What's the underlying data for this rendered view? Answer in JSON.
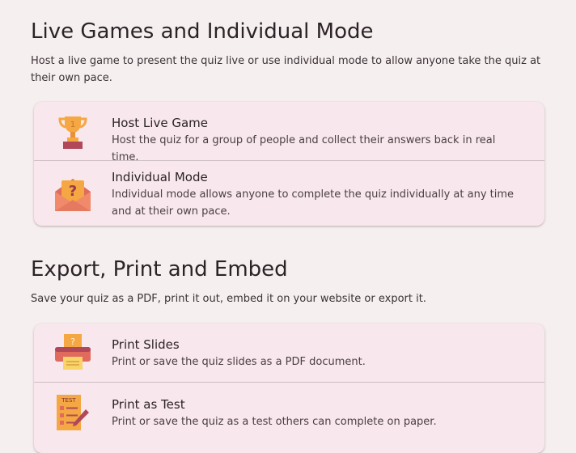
{
  "live": {
    "title": "Live Games and Individual Mode",
    "description": "Host a live game to present the quiz live or use individual mode to allow anyone take the quiz at their own pace.",
    "items": [
      {
        "icon": "trophy-icon",
        "title": "Host Live Game",
        "description": "Host the quiz for a group of people and collect their answers back in real time."
      },
      {
        "icon": "envelope-question-icon",
        "title": "Individual Mode",
        "description": "Individual mode allows anyone to complete the quiz individually at any time and at their own pace."
      }
    ]
  },
  "export": {
    "title": "Export, Print and Embed",
    "description": "Save your quiz as a PDF, print it out, embed it on your website or export it.",
    "items": [
      {
        "icon": "printer-icon",
        "title": "Print Slides",
        "description": "Print or save the quiz slides as a PDF document."
      },
      {
        "icon": "test-sheet-icon",
        "title": "Print as Test",
        "description": "Print or save the quiz as a test others can complete on paper."
      }
    ]
  },
  "icon_labels": {
    "trophy_number": "1",
    "question_mark": "?",
    "test_label": "TEST"
  },
  "colors": {
    "background": "#f6eff0",
    "card": "#f8e7ec",
    "icon_orange": "#f4a742",
    "icon_dark_red": "#b0485a",
    "icon_red": "#e06b5d"
  }
}
